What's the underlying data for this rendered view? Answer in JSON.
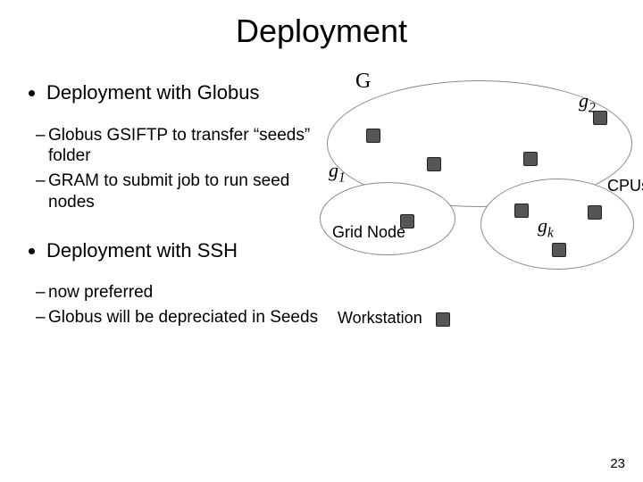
{
  "title": "Deployment",
  "bullets": {
    "b1": "Deployment with Globus",
    "b1_subs": [
      "Globus GSIFTP to transfer “seeds” folder",
      "GRAM to submit job to run seed nodes"
    ],
    "b2": "Deployment with SSH",
    "b2_subs": [
      "now preferred",
      "Globus will be depreciated in Seeds"
    ]
  },
  "diagram": {
    "G": "G",
    "g1": "g",
    "g1_sub": "1",
    "g2": "g",
    "g2_sub": "2",
    "gk": "g",
    "gk_sub": "k",
    "grid_node": "Grid Node",
    "cpus": "CPUs",
    "workstation": "Workstation"
  },
  "page": "23"
}
